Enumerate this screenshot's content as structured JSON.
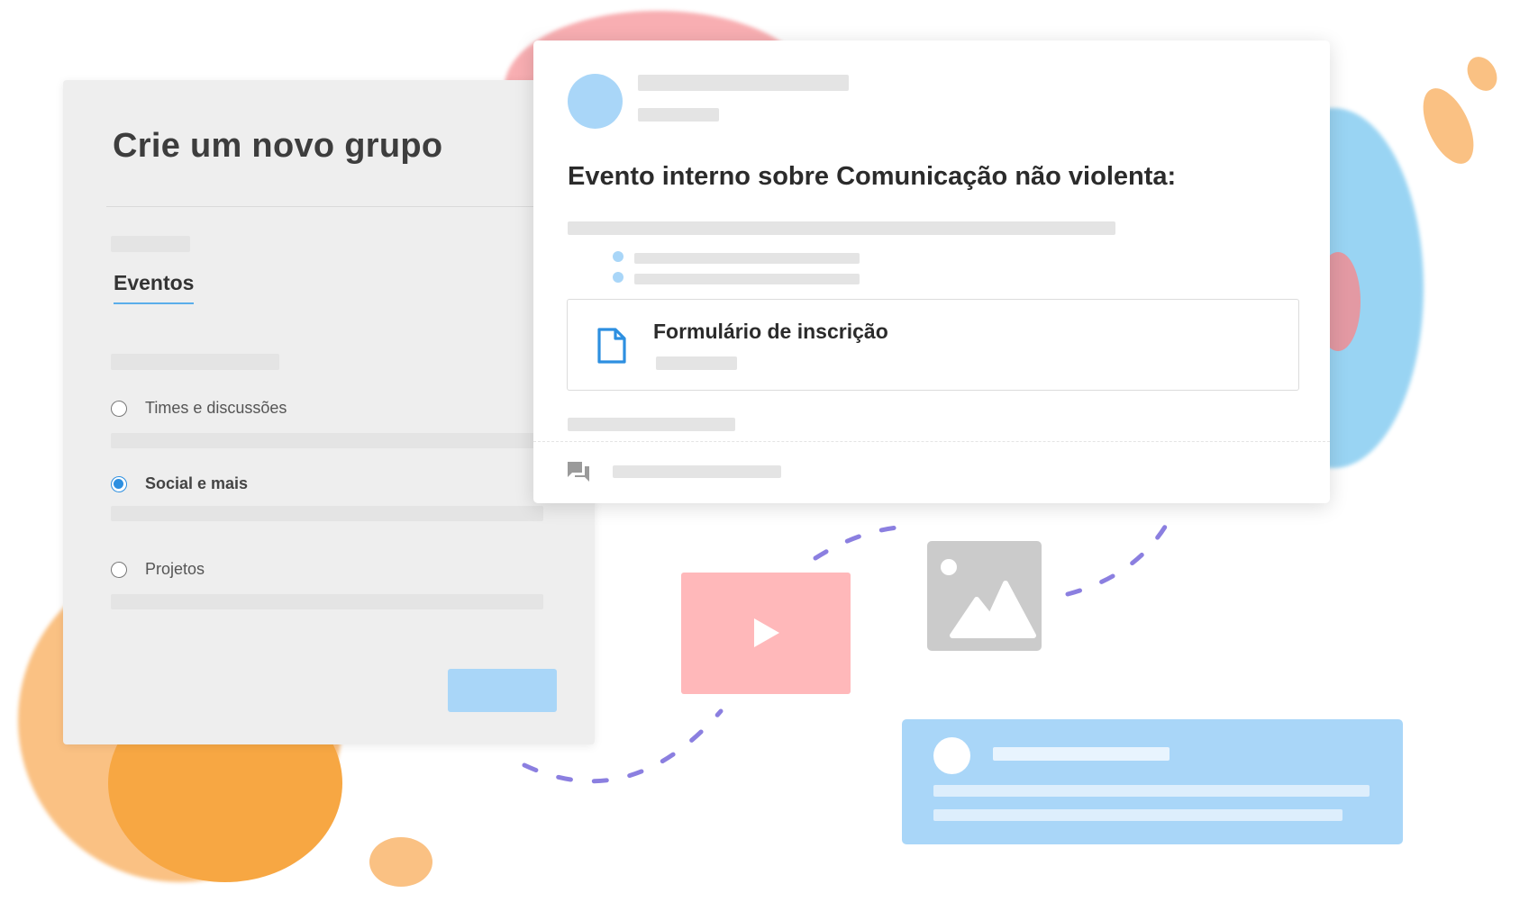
{
  "group_panel": {
    "title": "Crie um novo grupo",
    "tab_label": "Eventos",
    "options": [
      {
        "label": "Times e discussões",
        "selected": false
      },
      {
        "label": "Social e mais",
        "selected": true
      },
      {
        "label": "Projetos",
        "selected": false
      }
    ]
  },
  "event_card": {
    "title": "Evento interno sobre Comunicação não violenta:",
    "attachment": {
      "title": "Formulário de inscrição",
      "icon": "document-icon"
    },
    "footer_icon": "comment-icon"
  },
  "media": {
    "video_icon": "play-icon",
    "image_icon": "image-icon"
  },
  "colors": {
    "accent_blue": "#2d8fe0",
    "light_blue": "#a9d6f8",
    "video_pink": "#ffb8ba",
    "image_gray": "#cbcbcb",
    "panel_gray": "#eeeeee",
    "dash_purple": "#8b7fe0",
    "orange_blob": "#f8a94a",
    "red_blob": "#f58a8f",
    "sky_blob": "#7cc6ef"
  }
}
